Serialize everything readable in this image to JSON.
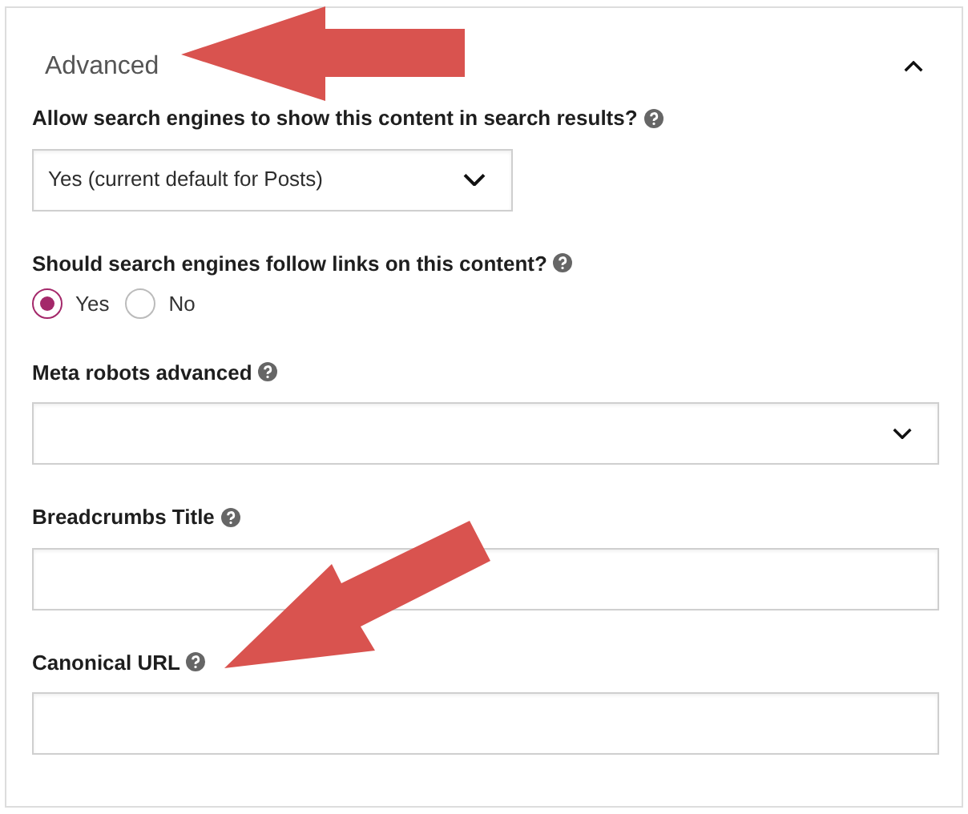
{
  "panel": {
    "title": "Advanced",
    "expanded": true
  },
  "fields": [
    {
      "kind": "select",
      "label": "Allow search engines to show this content in search results?",
      "value": "Yes (current default for Posts)",
      "wide": false
    },
    {
      "kind": "radio",
      "label": "Should search engines follow links on this content?",
      "options": [
        {
          "label": "Yes",
          "selected": true
        },
        {
          "label": "No",
          "selected": false
        }
      ]
    },
    {
      "kind": "select",
      "label": "Meta robots advanced",
      "wide": true
    },
    {
      "kind": "text",
      "label": "Breadcrumbs Title"
    },
    {
      "kind": "text",
      "label": "Canonical URL"
    }
  ]
}
